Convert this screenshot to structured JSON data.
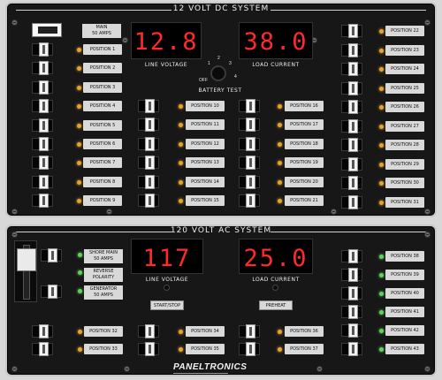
{
  "dc": {
    "title": "12 VOLT DC SYSTEM",
    "main_label_1": "MAIN",
    "main_label_2": "50 AMPS",
    "line_voltage_value": "12.8",
    "line_voltage_caption": "LINE VOLTAGE",
    "load_current_value": "38.0",
    "load_current_caption": "LOAD CURRENT",
    "battery_test_caption": "BATTERY TEST",
    "knob_ticks": [
      "OFF",
      "1",
      "2",
      "3",
      "4"
    ],
    "left_positions": [
      "POSITION 1",
      "POSITION 2",
      "POSITION 3",
      "POSITION 4",
      "POSITION 5",
      "POSITION 6",
      "POSITION 7",
      "POSITION 8",
      "POSITION 9"
    ],
    "mid_left_positions": [
      "POSITION 10",
      "POSITION 11",
      "POSITION 12",
      "POSITION 13",
      "POSITION 14",
      "POSITION 15"
    ],
    "mid_right_positions": [
      "POSITION 16",
      "POSITION 17",
      "POSITION 18",
      "POSITION 19",
      "POSITION 20",
      "POSITION 21"
    ],
    "right_positions": [
      "POSITION 22",
      "POSITION 23",
      "POSITION 24",
      "POSITION 25",
      "POSITION 26",
      "POSITION 27",
      "POSITION 28",
      "POSITION 29",
      "POSITION 30",
      "POSITION 31"
    ]
  },
  "ac": {
    "title": "120 VOLT AC SYSTEM",
    "shore_main_1": "SHORE MAIN",
    "shore_main_2": "50 AMPS",
    "reverse_polarity_1": "REVERSE",
    "reverse_polarity_2": "POLARITY",
    "generator_1": "GENERATOR",
    "generator_2": "50 AMPS",
    "line_voltage_value": "117",
    "line_voltage_caption": "LINE VOLTAGE",
    "load_current_value": "25.0",
    "load_current_caption": "LOAD CURRENT",
    "start_stop_label": "START/STOP",
    "preheat_label": "PREHEAT",
    "bottom_positions": [
      "POSITION 32",
      "POSITION 33",
      "POSITION 34",
      "POSITION 35",
      "POSITION 36",
      "POSITION 37"
    ],
    "right_positions": [
      "POSITION 38",
      "POSITION 39",
      "POSITION 40",
      "POSITION 41",
      "POSITION 42",
      "POSITION 43"
    ]
  },
  "brand": "PANELTRONICS",
  "colors": {
    "display_digits": "#ff2a2a",
    "led_amber": "#e9a12a",
    "led_green": "#5dd35a",
    "panel": "#171717"
  }
}
